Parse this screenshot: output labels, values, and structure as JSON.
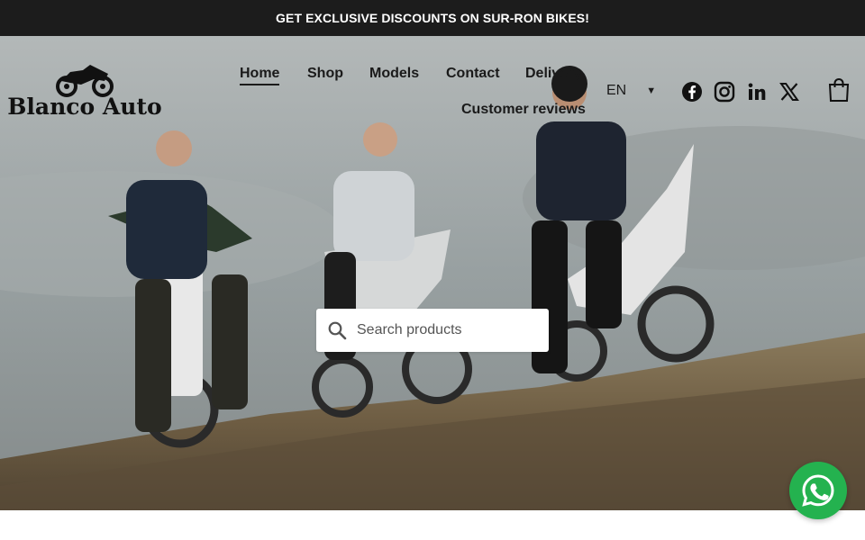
{
  "promo": {
    "text": "GET EXCLUSIVE DISCOUNTS ON SUR-RON BIKES!"
  },
  "logo": {
    "text": "Blanco Auto"
  },
  "nav": {
    "items": [
      "Home",
      "Shop",
      "Models",
      "Contact",
      "Delivery",
      "Customer reviews"
    ],
    "active": "Home"
  },
  "language": {
    "selected": "EN"
  },
  "social": [
    "facebook-icon",
    "instagram-icon",
    "linkedin-icon",
    "x-icon"
  ],
  "search": {
    "placeholder": "Search products"
  },
  "colors": {
    "promo_bg": "#1c1c1c",
    "whatsapp": "#24b24f",
    "text": "#1a1a1a"
  }
}
